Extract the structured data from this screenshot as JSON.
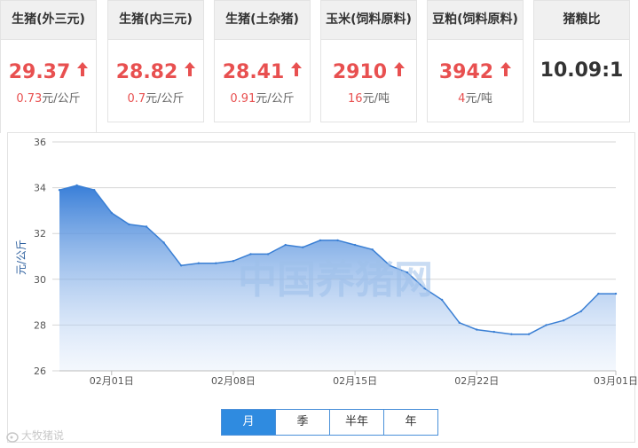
{
  "cards": [
    {
      "title": "生猪(外三元)",
      "value": "29.37",
      "change_num": "0.73",
      "change_unit": "元/公斤",
      "up": true
    },
    {
      "title": "生猪(内三元)",
      "value": "28.82",
      "change_num": "0.7",
      "change_unit": "元/公斤",
      "up": true
    },
    {
      "title": "生猪(土杂猪)",
      "value": "28.41",
      "change_num": "0.91",
      "change_unit": "元/公斤",
      "up": true
    },
    {
      "title": "玉米(饲料原料)",
      "value": "2910",
      "change_num": "16",
      "change_unit": "元/吨",
      "up": true
    },
    {
      "title": "豆粕(饲料原料)",
      "value": "3942",
      "change_num": "4",
      "change_unit": "元/吨",
      "up": true
    },
    {
      "title": "猪粮比",
      "value": "10.09:1",
      "change_num": "",
      "change_unit": "",
      "up": false
    }
  ],
  "colors": {
    "accent": "#2f8be0",
    "up": "#e85050",
    "line": "#3a7fd4"
  },
  "watermark_center": "中国养猪网",
  "watermark_corner": "大牧猪说",
  "range_buttons": [
    "月",
    "季",
    "半年",
    "年"
  ],
  "range_selected": "月",
  "chart_data": {
    "type": "area",
    "ylabel": "元/公斤",
    "ylim": [
      26,
      36
    ],
    "yticks": [
      26,
      28,
      30,
      32,
      34,
      36
    ],
    "xtick_labels": [
      "02月01日",
      "02月08日",
      "02月15日",
      "02月22日",
      "03月01日"
    ],
    "xtick_dates": [
      "2020-02-01",
      "2020-02-08",
      "2020-02-15",
      "2020-02-22",
      "2020-03-01"
    ],
    "x": [
      "2020-01-29",
      "2020-01-30",
      "2020-01-31",
      "2020-02-01",
      "2020-02-02",
      "2020-02-03",
      "2020-02-04",
      "2020-02-05",
      "2020-02-06",
      "2020-02-07",
      "2020-02-08",
      "2020-02-09",
      "2020-02-10",
      "2020-02-11",
      "2020-02-12",
      "2020-02-13",
      "2020-02-14",
      "2020-02-15",
      "2020-02-16",
      "2020-02-17",
      "2020-02-18",
      "2020-02-19",
      "2020-02-20",
      "2020-02-21",
      "2020-02-22",
      "2020-02-23",
      "2020-02-24",
      "2020-02-25",
      "2020-02-26",
      "2020-02-27",
      "2020-02-28",
      "2020-02-29",
      "2020-03-01"
    ],
    "values": [
      33.9,
      34.1,
      33.9,
      32.9,
      32.4,
      32.3,
      31.6,
      30.6,
      30.7,
      30.7,
      30.8,
      31.1,
      31.1,
      31.5,
      31.4,
      31.7,
      31.7,
      31.5,
      31.3,
      30.6,
      30.3,
      29.6,
      29.1,
      28.1,
      27.8,
      27.7,
      27.6,
      27.6,
      28.0,
      28.2,
      28.6,
      29.37,
      29.37
    ]
  }
}
